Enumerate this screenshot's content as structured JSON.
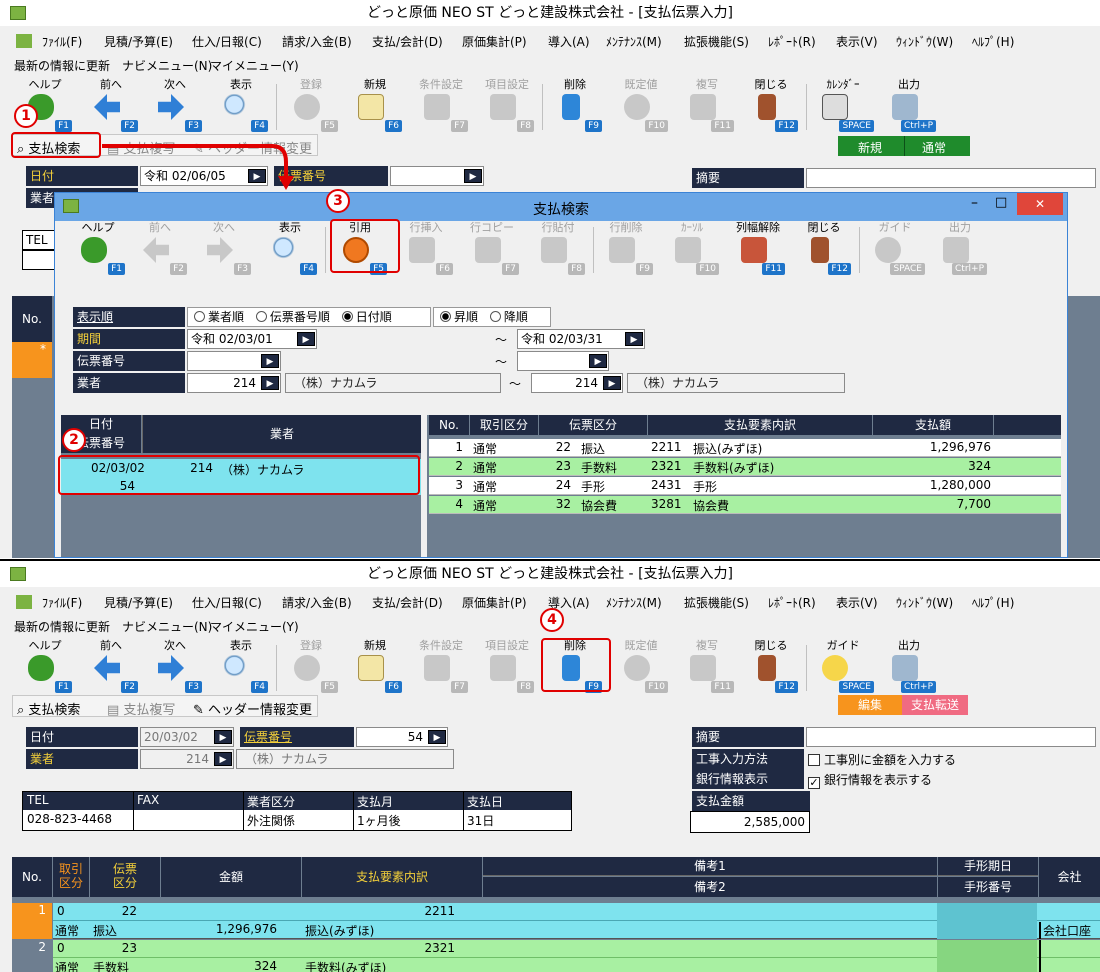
{
  "top": {
    "title": "どっと原価 NEO ST どっと建設株式会社 - [支払伝票入力]",
    "menu": [
      "ﾌｧｲﾙ(F)",
      "見積/予算(E)",
      "仕入/日報(C)",
      "請求/入金(B)",
      "支払/会計(D)",
      "原価集計(P)",
      "導入(A)",
      "ﾒﾝﾃﾅﾝｽ(M)",
      "拡張機能(S)",
      "ﾚﾎﾟｰﾄ(R)",
      "表示(V)",
      "ｳｨﾝﾄﾞｳ(W)",
      "ﾍﾙﾌﾟ(H)"
    ],
    "subbar": [
      "最新の情報に更新",
      "ナビメニュー(N)",
      "マイメニュー(Y)"
    ],
    "toolbar": [
      {
        "label": "ヘルプ",
        "key": "F1"
      },
      {
        "label": "前へ",
        "key": "F2"
      },
      {
        "label": "次へ",
        "key": "F3"
      },
      {
        "label": "表示",
        "key": "F4"
      },
      {
        "label": "登録",
        "key": "F5"
      },
      {
        "label": "新規",
        "key": "F6"
      },
      {
        "label": "条件設定",
        "key": "F7"
      },
      {
        "label": "項目設定",
        "key": "F8"
      },
      {
        "label": "削除",
        "key": "F9"
      },
      {
        "label": "既定値",
        "key": "F10"
      },
      {
        "label": "複写",
        "key": "F11"
      },
      {
        "label": "閉じる",
        "key": "F12"
      },
      {
        "label": "ｶﾚﾝﾀﾞｰ",
        "key": "SPACE"
      },
      {
        "label": "出力",
        "key": "Ctrl+P"
      }
    ],
    "actions": [
      "支払検索",
      "支払複写",
      "ヘッダー情報変更"
    ],
    "mode": [
      "新規",
      "通常"
    ],
    "date_label": "日付",
    "date_value": "令和 02/06/05",
    "denpyo_label": "伝票番号",
    "gyosha_label": "業者",
    "tekiyo_label": "摘要",
    "tel_label": "TEL",
    "no_label": "No."
  },
  "dialog": {
    "title": "支払検索",
    "toolbar": [
      {
        "label": "ヘルプ",
        "key": "F1"
      },
      {
        "label": "前へ",
        "key": "F2"
      },
      {
        "label": "次へ",
        "key": "F3"
      },
      {
        "label": "表示",
        "key": "F4"
      },
      {
        "label": "引用",
        "key": "F5"
      },
      {
        "label": "行挿入",
        "key": "F6"
      },
      {
        "label": "行コピー",
        "key": "F7"
      },
      {
        "label": "行貼付",
        "key": "F8"
      },
      {
        "label": "行削除",
        "key": "F9"
      },
      {
        "label": "ｶｰｿﾙ",
        "key": "F10"
      },
      {
        "label": "列幅解除",
        "key": "F11"
      },
      {
        "label": "閉じる",
        "key": "F12"
      },
      {
        "label": "ガイド",
        "key": "SPACE"
      },
      {
        "label": "出力",
        "key": "Ctrl+P"
      }
    ],
    "sort_label": "表示順",
    "sort_options": [
      "業者順",
      "伝票番号順",
      "日付順"
    ],
    "order_options": [
      "昇順",
      "降順"
    ],
    "period_label": "期間",
    "period_from": "令和 02/03/01",
    "period_to": "令和 02/03/31",
    "denpyo_label": "伝票番号",
    "gyosha_label": "業者",
    "gyosha_from_code": "214",
    "gyosha_from_name": "（株）ナカムラ",
    "gyosha_to_code": "214",
    "gyosha_to_name": "（株）ナカムラ",
    "tilde": "～",
    "left_headers": [
      "日付",
      "伝票番号",
      "業者"
    ],
    "left_row": {
      "date": "02/03/02",
      "code": "214",
      "name": "（株）ナカムラ",
      "denpyo": "54"
    },
    "right_headers": [
      "No.",
      "取引区分",
      "伝票区分",
      "支払要素内訳",
      "支払額"
    ],
    "right_rows": [
      {
        "no": "1",
        "torihiki": "通常",
        "dk_code": "22",
        "dk_name": "振込",
        "yoso_code": "2211",
        "yoso_name": "振込(みずほ)",
        "amount": "1,296,976"
      },
      {
        "no": "2",
        "torihiki": "通常",
        "dk_code": "23",
        "dk_name": "手数料",
        "yoso_code": "2321",
        "yoso_name": "手数料(みずほ)",
        "amount": "324"
      },
      {
        "no": "3",
        "torihiki": "通常",
        "dk_code": "24",
        "dk_name": "手形",
        "yoso_code": "2431",
        "yoso_name": "手形",
        "amount": "1,280,000"
      },
      {
        "no": "4",
        "torihiki": "通常",
        "dk_code": "32",
        "dk_name": "協会費",
        "yoso_code": "3281",
        "yoso_name": "協会費",
        "amount": "7,700"
      }
    ]
  },
  "bottom": {
    "title": "どっと原価 NEO ST どっと建設株式会社 - [支払伝票入力]",
    "toolbar": [
      {
        "label": "ヘルプ",
        "key": "F1"
      },
      {
        "label": "前へ",
        "key": "F2"
      },
      {
        "label": "次へ",
        "key": "F3"
      },
      {
        "label": "表示",
        "key": "F4"
      },
      {
        "label": "登録",
        "key": "F5"
      },
      {
        "label": "新規",
        "key": "F6"
      },
      {
        "label": "条件設定",
        "key": "F7"
      },
      {
        "label": "項目設定",
        "key": "F8"
      },
      {
        "label": "削除",
        "key": "F9"
      },
      {
        "label": "既定値",
        "key": "F10"
      },
      {
        "label": "複写",
        "key": "F11"
      },
      {
        "label": "閉じる",
        "key": "F12"
      },
      {
        "label": "ガイド",
        "key": "SPACE"
      },
      {
        "label": "出力",
        "key": "Ctrl+P"
      }
    ],
    "actions": [
      "支払検索",
      "支払複写",
      "ヘッダー情報変更"
    ],
    "mode": [
      "編集",
      "支払転送"
    ],
    "date_label": "日付",
    "date_value": "20/03/02",
    "denpyo_label": "伝票番号",
    "denpyo_value": "54",
    "gyosha_label": "業者",
    "gyosha_code": "214",
    "gyosha_name": "（株）ナカムラ",
    "info_headers": [
      "TEL",
      "FAX",
      "業者区分",
      "支払月",
      "支払日"
    ],
    "info_values": [
      "028-823-4468",
      "",
      "外注関係",
      "1ヶ月後",
      "31日"
    ],
    "tekiyo_label": "摘要",
    "koji_label": "工事入力方法",
    "koji_check": "工事別に金額を入力する",
    "bank_label": "銀行情報表示",
    "bank_check": "銀行情報を表示する",
    "total_label": "支払金額",
    "total_value": "2,585,000",
    "grid_headers": {
      "no": "No.",
      "torihiki": "取引区分",
      "denpyo": "伝票区分",
      "kingaku": "金額",
      "yoso": "支払要素内訳",
      "biko1": "備考1",
      "biko2": "備考2",
      "tegata1": "手形期日",
      "tegata2": "手形番号",
      "kaisha": "会社"
    },
    "rows": [
      {
        "no": "1",
        "t_code": "0",
        "t_name": "通常",
        "d_code": "22",
        "d_name": "振込",
        "amount": "1,296,976",
        "yoso_code": "2211",
        "yoso_name": "振込(みずほ)",
        "kaisha": "会社口座"
      },
      {
        "no": "2",
        "t_code": "0",
        "t_name": "通常",
        "d_code": "23",
        "d_name": "手数料",
        "amount": "324",
        "yoso_code": "2321",
        "yoso_name": "手数料(みずほ)",
        "kaisha": ""
      }
    ]
  },
  "badges": [
    "1",
    "2",
    "3",
    "4"
  ],
  "colors": {
    "navy": "#1f2942",
    "cyan": "#7ee3ee",
    "green": "#a8f0a2",
    "orange": "#f7941d",
    "red": "#e00000",
    "mode_green": "#1f8b2c",
    "mode_orange": "#f7941d",
    "mode_pink": "#f06b82"
  }
}
